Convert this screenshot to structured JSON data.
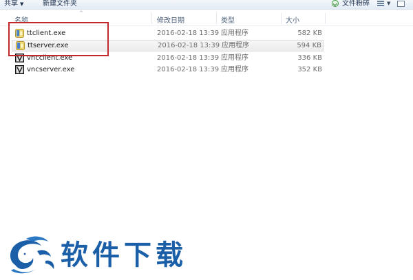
{
  "toolbar": {
    "share_label": "共享",
    "share_caret": "▼",
    "new_folder_label": "新建文件夹",
    "crush_label": "文件粉碎",
    "view_caret": "▼"
  },
  "columns": {
    "name": "名称",
    "date": "修改日期",
    "type": "类型",
    "size": "大小",
    "sort_indicator": "^"
  },
  "files": [
    {
      "name": "ttclient.exe",
      "date": "2016-02-18 13:39",
      "type": "应用程序",
      "size": "582 KB",
      "icon": "tt-app-icon",
      "selected": false
    },
    {
      "name": "ttserver.exe",
      "date": "2016-02-18 13:39",
      "type": "应用程序",
      "size": "594 KB",
      "icon": "tt-app-icon",
      "selected": true
    },
    {
      "name": "vncclient.exe",
      "date": "2016-02-18 13:39",
      "type": "应用程序",
      "size": "336 KB",
      "icon": "vnc-app-icon",
      "selected": false
    },
    {
      "name": "vncserver.exe",
      "date": "2016-02-18 13:39",
      "type": "应用程序",
      "size": "352 KB",
      "icon": "vnc-app-icon",
      "selected": false
    }
  ],
  "watermark": {
    "text": "软件下载",
    "color": "#1b5fa8"
  },
  "colors": {
    "highlight_border": "#c3262c",
    "selected_row": "#ececec"
  }
}
